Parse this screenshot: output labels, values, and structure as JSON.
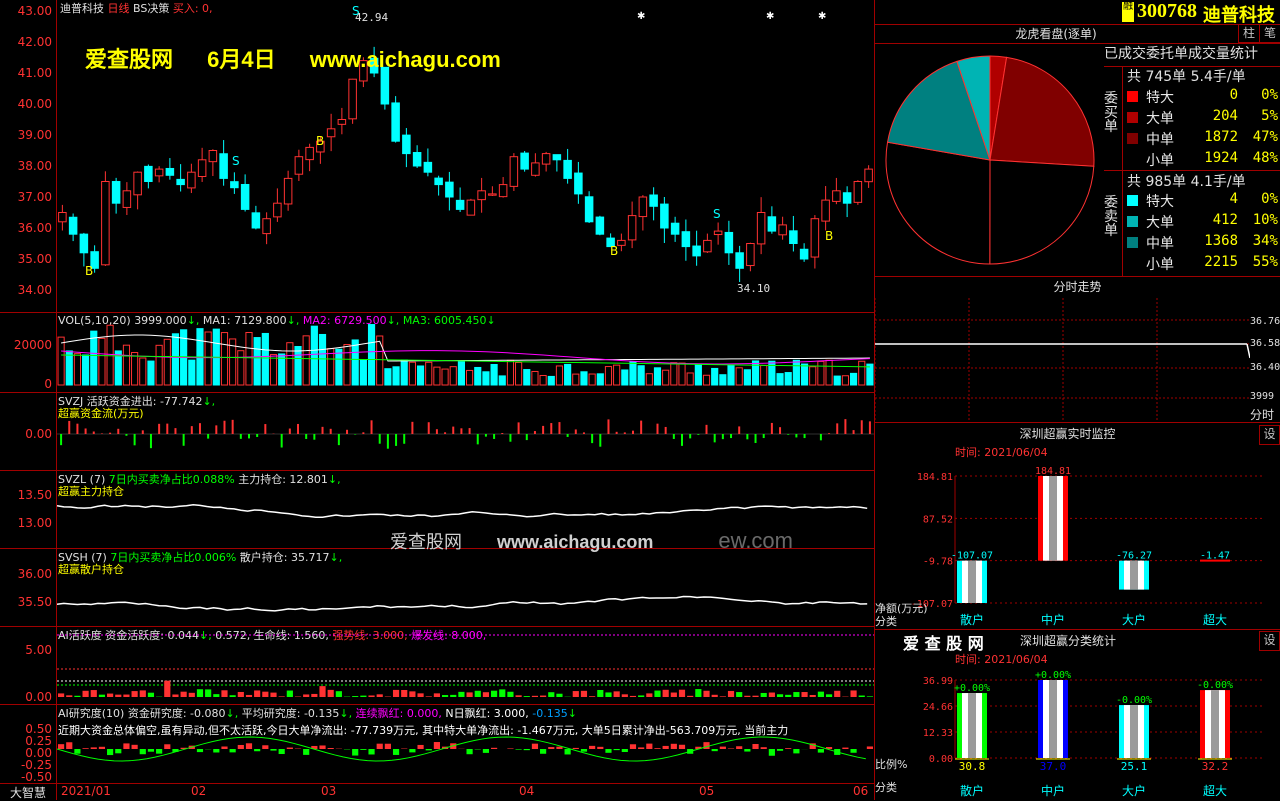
{
  "app": {
    "name": "大智慧"
  },
  "stock": {
    "code": "300768",
    "name": "迪普科技",
    "badge": "融"
  },
  "main_chart": {
    "title": "迪普科技",
    "period": "日线",
    "indicator": "BS决策",
    "buy_text": "买入: 0,",
    "high_label": "42.94",
    "low_label": "34.10",
    "y_ticks": [
      "43.00",
      "42.00",
      "41.00",
      "40.00",
      "39.00",
      "38.00",
      "37.00",
      "36.00",
      "35.00",
      "34.00"
    ],
    "markers": {
      "sell": "S",
      "buy": "B"
    }
  },
  "watermark": {
    "site": "爱查股网",
    "date": "6月4日",
    "url": "www.aichagu.com"
  },
  "watermark2": {
    "site": "爱查股网",
    "url": "www.aichagu.com",
    "ghost": "ew.com"
  },
  "vol_panel": {
    "label": "VOL(5,10,20)",
    "value": "3999.000",
    "ma1_label": "MA1:",
    "ma1": "7129.800",
    "ma2_label": "MA2:",
    "ma2": "6729.500",
    "ma3_label": "MA3:",
    "ma3": "6005.450",
    "y_ticks": [
      "20000",
      "10000",
      "0"
    ]
  },
  "svzj_panel": {
    "label": "SVZJ",
    "text": "活跃资金进出: -77.742",
    "subtitle": "超赢资金流(万元)",
    "y_ticks": [
      "0.00"
    ]
  },
  "svzl_panel": {
    "label": "SVZL (7)",
    "text1": "7日内买卖净占比0.088%",
    "text2": "主力持仓: 12.801",
    "subtitle": "超赢主力持仓",
    "y_ticks": [
      "13.50",
      "13.00"
    ]
  },
  "svsh_panel": {
    "label": "SVSH (7)",
    "text1": "7日内买卖净占比0.006%",
    "text2": "散户持仓: 35.717",
    "subtitle": "超赢散户持仓",
    "y_ticks": [
      "36.00",
      "35.50"
    ]
  },
  "ai_active_panel": {
    "label": "AI活跃度",
    "text1": "资金活跃度: 0.044",
    "text2": "0.572, 生命线: 1.560,",
    "strong": "强势线: 3.000,",
    "burst": "爆发线: 8.000,",
    "y_ticks": [
      "5.00",
      "0.00"
    ]
  },
  "ai_research_panel": {
    "label": "AI研究度(10)",
    "text1": "资金研究度: -0.080",
    "text2": "平均研究度: -0.135",
    "red": "连续飘红: 0.000,",
    "n_red": "N日飘红: 3.000,",
    "val": "-0.135",
    "comment": "近期大资金总体偏空,虽有异动,但不太活跃,今日大单净流出: -77.739万元, 其中特大单净流出: -1.467万元, 大单5日累计净出-563.709万元, 当前主力",
    "y_ticks": [
      "0.50",
      "0.25",
      "0.00",
      "-0.25",
      "-0.50"
    ]
  },
  "x_axis": {
    "labels": [
      "2021/01",
      "02",
      "03",
      "04",
      "05",
      "06"
    ]
  },
  "tabs": {
    "bar": "柱",
    "pen": "笔"
  },
  "dragon": {
    "title": "龙虎看盘(逐单)",
    "subtitle": "已成交委托单成交量统计",
    "buy": {
      "vert": "委买单",
      "total": "共 745单 5.4手/单",
      "rows": [
        {
          "label": "特大",
          "count": "0",
          "pct": "0%",
          "color": "#ff0000"
        },
        {
          "label": "大单",
          "count": "204",
          "pct": "5%",
          "color": "#b00000"
        },
        {
          "label": "中单",
          "count": "1872",
          "pct": "47%",
          "color": "#800000"
        },
        {
          "label": "小单",
          "count": "1924",
          "pct": "48%",
          "color": "#000000"
        }
      ]
    },
    "sell": {
      "vert": "委卖单",
      "total": "共 985单 4.1手/单",
      "rows": [
        {
          "label": "特大",
          "count": "4",
          "pct": "0%",
          "color": "#00ffff"
        },
        {
          "label": "大单",
          "count": "412",
          "pct": "10%",
          "color": "#00b4b4"
        },
        {
          "label": "中单",
          "count": "1368",
          "pct": "34%",
          "color": "#008080"
        },
        {
          "label": "小单",
          "count": "2215",
          "pct": "55%",
          "color": "#000000"
        }
      ]
    }
  },
  "intraday": {
    "title": "分时走势",
    "y_ticks": [
      "36.76",
      "36.58",
      "36.40"
    ],
    "vol": "3999",
    "vol_label": "分时"
  },
  "monitor": {
    "title": "深圳超赢实时监控",
    "set": "设",
    "time_label": "时间: 2021/06/04",
    "y_ticks": [
      "184.81",
      "87.52",
      "-9.78",
      "-107.07"
    ],
    "unit_label": "净额(万元)",
    "cat_label": "分类",
    "categories": [
      "散户",
      "中户",
      "大户",
      "超大"
    ],
    "value_labels": [
      "-107.07",
      "184.81",
      "-76.27",
      "-1.47"
    ]
  },
  "classify": {
    "brand": "爱 查 股 网",
    "title": "深圳超赢分类统计",
    "set": "设",
    "time_label": "时间: 2021/06/04",
    "y_ticks": [
      "36.99",
      "24.66",
      "12.33",
      "0.00"
    ],
    "ratio_label": "比例%",
    "cat_label": "分类",
    "categories": [
      "散户",
      "中户",
      "大户",
      "超大"
    ],
    "top_labels": [
      "+0.00%",
      "+0.00%",
      "-0.00%",
      "-0.00%"
    ],
    "values": [
      "30.8",
      "37.0",
      "25.1",
      "32.2"
    ]
  },
  "chart_data": [
    {
      "type": "bar",
      "title": "深圳超赢实时监控",
      "ylabel": "净额(万元)",
      "categories": [
        "散户",
        "中户",
        "大户",
        "超大"
      ],
      "values": [
        -107.07,
        184.81,
        -76.27,
        -1.47
      ],
      "ylim": [
        -107.07,
        184.81
      ]
    },
    {
      "type": "bar",
      "title": "深圳超赢分类统计",
      "ylabel": "比例%",
      "categories": [
        "散户",
        "中户",
        "大户",
        "超大"
      ],
      "values": [
        30.8,
        37.0,
        25.1,
        32.2
      ],
      "ylim": [
        0,
        36.99
      ]
    },
    {
      "type": "pie",
      "title": "龙虎看盘(逐单)",
      "categories": [
        "买特大",
        "买大单",
        "买中单",
        "买小单",
        "卖特大",
        "卖大单",
        "卖中单",
        "卖小单"
      ],
      "values": [
        0,
        204,
        1872,
        1924,
        4,
        412,
        1368,
        2215
      ]
    }
  ]
}
